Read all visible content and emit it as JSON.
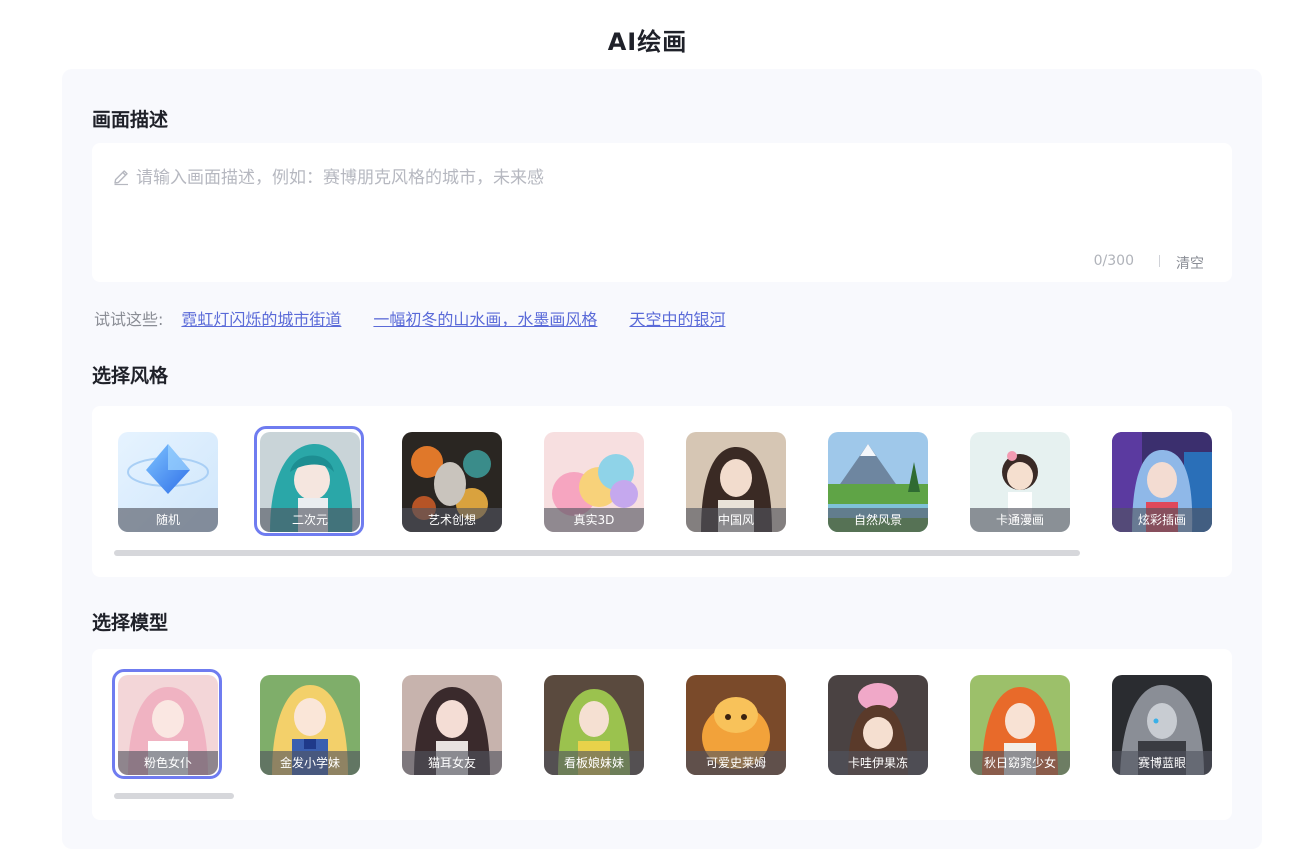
{
  "page": {
    "title": "AI绘画"
  },
  "description": {
    "heading": "画面描述",
    "placeholder": "请输入画面描述，例如：赛博朋克风格的城市，未来感",
    "value": "",
    "counter": "0/300",
    "clear_label": "清空"
  },
  "suggestions": {
    "label": "试试这些:",
    "items": [
      "霓虹灯闪烁的城市街道",
      "一幅初冬的山水画，水墨画风格",
      "天空中的银河"
    ]
  },
  "style_section": {
    "heading": "选择风格",
    "selected_index": 1,
    "items": [
      {
        "label": "随机"
      },
      {
        "label": "二次元"
      },
      {
        "label": "艺术创想"
      },
      {
        "label": "真实3D"
      },
      {
        "label": "中国风"
      },
      {
        "label": "自然风景"
      },
      {
        "label": "卡通漫画"
      },
      {
        "label": "炫彩插画"
      }
    ]
  },
  "model_section": {
    "heading": "选择模型",
    "selected_index": 0,
    "items": [
      {
        "label": "粉色女仆"
      },
      {
        "label": "金发小学妹"
      },
      {
        "label": "猫耳女友"
      },
      {
        "label": "看板娘妹妹"
      },
      {
        "label": "可爱史莱姆"
      },
      {
        "label": "卡哇伊果冻"
      },
      {
        "label": "秋日窈窕少女"
      },
      {
        "label": "赛博蓝眼"
      }
    ]
  },
  "colors": {
    "accent": "#6f7cf0",
    "link": "#5a6ad8",
    "panel_bg": "#f8f9fd"
  }
}
